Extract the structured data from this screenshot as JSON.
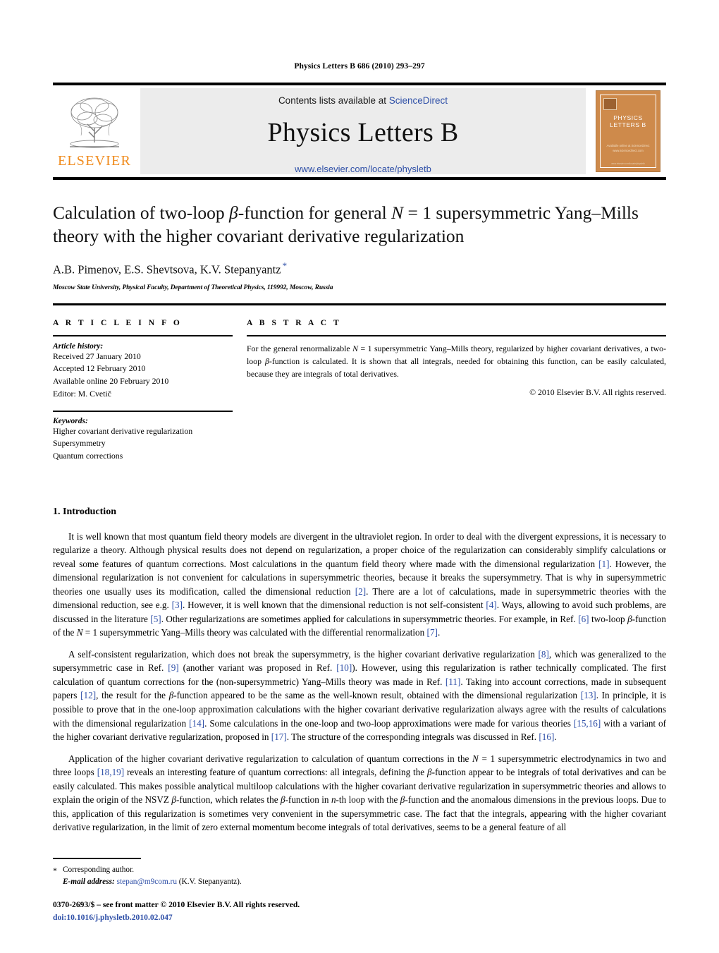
{
  "running_head": "Physics Letters B 686 (2010) 293–297",
  "masthead": {
    "contents_prefix": "Contents lists available at ",
    "sciencedirect_link": "ScienceDirect",
    "journal_title": "Physics Letters B",
    "journal_url": "www.elsevier.com/locate/physletb",
    "publisher_logo_text": "ELSEVIER",
    "cover": {
      "title": "PHYSICS LETTERS B",
      "subtitle": "Available online at\nScienceDirect\nwww.sciencedirect.com",
      "footer": "www.elsevier.com/locate/physletb"
    },
    "link_color": "#2E4FA7",
    "panel_color": "#ececec",
    "brand_orange": "#F08B1D"
  },
  "article": {
    "title_line1_a": "Calculation of two-loop ",
    "title_beta": "β",
    "title_line1_b": "-function for general ",
    "title_N": "N",
    "title_line1_c": " = 1 supersymmetric Yang–Mills",
    "title_line2": "theory with the higher covariant derivative regularization",
    "authors": "A.B. Pimenov, E.S. Shevtsova, K.V. Stepanyantz",
    "corresponding_marker": "*",
    "affiliation": "Moscow State University, Physical Faculty, Department of Theoretical Physics, 119992, Moscow, Russia"
  },
  "info": {
    "heading": "A R T I C L E    I N F O",
    "history_label": "Article history:",
    "history": [
      "Received 27 January 2010",
      "Accepted 12 February 2010",
      "Available online 20 February 2010",
      "Editor: M. Cvetič"
    ],
    "keywords_label": "Keywords:",
    "keywords": [
      "Higher covariant derivative regularization",
      "Supersymmetry",
      "Quantum corrections"
    ]
  },
  "abstract": {
    "heading": "A B S T R A C T",
    "text_a": "For the general renormalizable ",
    "text_N": "N",
    "text_b": " = 1 supersymmetric Yang–Mills theory, regularized by higher covariant derivatives, a two-loop ",
    "text_beta": "β",
    "text_c": "-function is calculated. It is shown that all integrals, needed for obtaining this function, can be easily calculated, because they are integrals of total derivatives.",
    "copyright": "© 2010 Elsevier B.V. All rights reserved."
  },
  "body": {
    "section_number": "1.",
    "section_title": "Introduction",
    "paragraphs": [
      {
        "id": "p1",
        "segments": [
          {
            "t": "It is well known that most quantum field theory models are divergent in the ultraviolet region. In order to deal with the divergent expressions, it is necessary to regularize a theory. Although physical results does not depend on regularization, a proper choice of the regularization can considerably simplify calculations or reveal some features of quantum corrections. Most calculations in the quantum field theory where made with the dimensional regularization "
          },
          {
            "t": "[1]",
            "k": "ref"
          },
          {
            "t": ". However, the dimensional regularization is not convenient for calculations in supersymmetric theories, because it breaks the supersymmetry. That is why in supersymmetric theories one usually uses its modification, called the dimensional reduction "
          },
          {
            "t": "[2]",
            "k": "ref"
          },
          {
            "t": ". There are a lot of calculations, made in supersymmetric theories with the dimensional reduction, see e.g. "
          },
          {
            "t": "[3]",
            "k": "ref"
          },
          {
            "t": ". However, it is well known that the dimensional reduction is not self-consistent "
          },
          {
            "t": "[4]",
            "k": "ref"
          },
          {
            "t": ". Ways, allowing to avoid such problems, are discussed in the literature "
          },
          {
            "t": "[5]",
            "k": "ref"
          },
          {
            "t": ". Other regularizations are sometimes applied for calculations in supersymmetric theories. For example, in Ref. "
          },
          {
            "t": "[6]",
            "k": "ref"
          },
          {
            "t": " two-loop "
          },
          {
            "t": "β",
            "k": "ital"
          },
          {
            "t": "-function of the "
          },
          {
            "t": "N",
            "k": "ital"
          },
          {
            "t": " = 1 supersymmetric Yang–Mills theory was calculated with the differential renormalization "
          },
          {
            "t": "[7]",
            "k": "ref"
          },
          {
            "t": "."
          }
        ]
      },
      {
        "id": "p2",
        "segments": [
          {
            "t": "A self-consistent regularization, which does not break the supersymmetry, is the higher covariant derivative regularization "
          },
          {
            "t": "[8]",
            "k": "ref"
          },
          {
            "t": ", which was generalized to the supersymmetric case in Ref. "
          },
          {
            "t": "[9]",
            "k": "ref"
          },
          {
            "t": " (another variant was proposed in Ref. "
          },
          {
            "t": "[10]",
            "k": "ref"
          },
          {
            "t": "). However, using this regularization is rather technically complicated. The first calculation of quantum corrections for the (non-supersymmetric) Yang–Mills theory was made in Ref. "
          },
          {
            "t": "[11]",
            "k": "ref"
          },
          {
            "t": ". Taking into account corrections, made in subsequent papers "
          },
          {
            "t": "[12]",
            "k": "ref"
          },
          {
            "t": ", the result for the "
          },
          {
            "t": "β",
            "k": "ital"
          },
          {
            "t": "-function appeared to be the same as the well-known result, obtained with the dimensional regularization "
          },
          {
            "t": "[13]",
            "k": "ref"
          },
          {
            "t": ". In principle, it is possible to prove that in the one-loop approximation calculations with the higher covariant derivative regularization always agree with the results of calculations with the dimensional regularization "
          },
          {
            "t": "[14]",
            "k": "ref"
          },
          {
            "t": ". Some calculations in the one-loop and two-loop approximations were made for various theories "
          },
          {
            "t": "[15,16]",
            "k": "ref"
          },
          {
            "t": " with a variant of the higher covariant derivative regularization, proposed in "
          },
          {
            "t": "[17]",
            "k": "ref"
          },
          {
            "t": ". The structure of the corresponding integrals was discussed in Ref. "
          },
          {
            "t": "[16]",
            "k": "ref"
          },
          {
            "t": "."
          }
        ]
      },
      {
        "id": "p3",
        "segments": [
          {
            "t": "Application of the higher covariant derivative regularization to calculation of quantum corrections in the "
          },
          {
            "t": "N",
            "k": "ital"
          },
          {
            "t": " = 1 supersymmetric electrodynamics in two and three loops "
          },
          {
            "t": "[18,19]",
            "k": "ref"
          },
          {
            "t": " reveals an interesting feature of quantum corrections: all integrals, defining the "
          },
          {
            "t": "β",
            "k": "ital"
          },
          {
            "t": "-function appear to be integrals of total derivatives and can be easily calculated. This makes possible analytical multiloop calculations with the higher covariant derivative regularization in supersymmetric theories and allows to explain the origin of the NSVZ "
          },
          {
            "t": "β",
            "k": "ital"
          },
          {
            "t": "-function, which relates the "
          },
          {
            "t": "β",
            "k": "ital"
          },
          {
            "t": "-function in "
          },
          {
            "t": "n",
            "k": "ital"
          },
          {
            "t": "-th loop with the "
          },
          {
            "t": "β",
            "k": "ital"
          },
          {
            "t": "-function and the anomalous dimensions in the previous loops. Due to this, application of this regularization is sometimes very convenient in the supersymmetric case. The fact that the integrals, appearing with the higher covariant derivative regularization, in the limit of zero external momentum become integrals of total derivatives, seems to be a general feature of all"
          }
        ]
      }
    ]
  },
  "footnote": {
    "star": "*",
    "corresponding": "Corresponding author.",
    "email_label": "E-mail address:",
    "email": "stepan@m9com.ru",
    "email_owner": "(K.V. Stepanyantz).",
    "front_matter": "0370-2693/$ – see front matter  © 2010 Elsevier B.V. All rights reserved.",
    "doi": "doi:10.1016/j.physletb.2010.02.047"
  }
}
